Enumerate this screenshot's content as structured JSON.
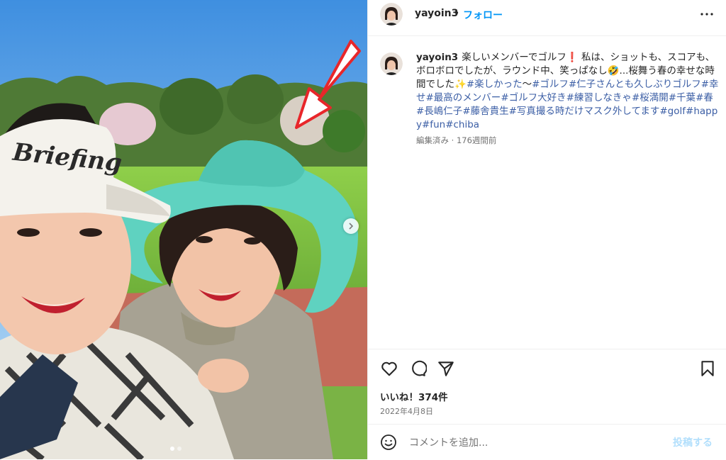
{
  "post": {
    "username": "yayoin3",
    "separator": "•",
    "follow_label": "フォロー",
    "more_icon": "more-horizontal-icon"
  },
  "caption": {
    "username": "yayoin3",
    "text_parts": [
      {
        "text": "楽しいメンバーでゴルフ❗ 私は、ショットも、スコアも、ボロボロでしたが、ラウンド中、笑っぱなし🤣...桜舞う春の幸せな時間でした✨",
        "tag": false
      },
      {
        "text": "#楽しかった",
        "tag": true
      },
      {
        "text": "〜",
        "tag": false
      },
      {
        "text": "#ゴルフ",
        "tag": true
      },
      {
        "text": "#仁子さんとも久しぶりゴルフ",
        "tag": true
      },
      {
        "text": "#幸せ",
        "tag": true
      },
      {
        "text": "#最高のメンバー",
        "tag": true
      },
      {
        "text": "#ゴルフ大好き",
        "tag": true
      },
      {
        "text": "#練習しなきゃ",
        "tag": true
      },
      {
        "text": "#桜満開",
        "tag": true
      },
      {
        "text": "#千葉",
        "tag": true
      },
      {
        "text": "#春",
        "tag": true
      },
      {
        "text": "#長嶋仁子",
        "tag": true
      },
      {
        "text": "#藤舎貴生",
        "tag": true
      },
      {
        "text": "#写真撮る時だけマスク外してます",
        "tag": true
      },
      {
        "text": "#golf",
        "tag": true
      },
      {
        "text": "#happy",
        "tag": true
      },
      {
        "text": "#fun",
        "tag": true
      },
      {
        "text": "#chiba",
        "tag": true
      }
    ],
    "meta": "編集済み · 176週間前"
  },
  "actions": {
    "like_icon": "heart-icon",
    "comment_icon": "comment-icon",
    "share_icon": "send-icon",
    "save_icon": "bookmark-icon",
    "likes_text": "いいね！374件",
    "date": "2022年4月8日"
  },
  "comment": {
    "emoji_icon": "emoji-icon",
    "placeholder": "コメントを追加...",
    "post_label": "投稿する"
  },
  "photo": {
    "visor_brand": "Briefing",
    "carousel_pages": 2,
    "current_page": 1
  },
  "colors": {
    "link_blue": "#0095f6",
    "hashtag": "#3b5ea5",
    "arrow_red": "#e8262a",
    "hat_teal": "#5fd2c0"
  }
}
